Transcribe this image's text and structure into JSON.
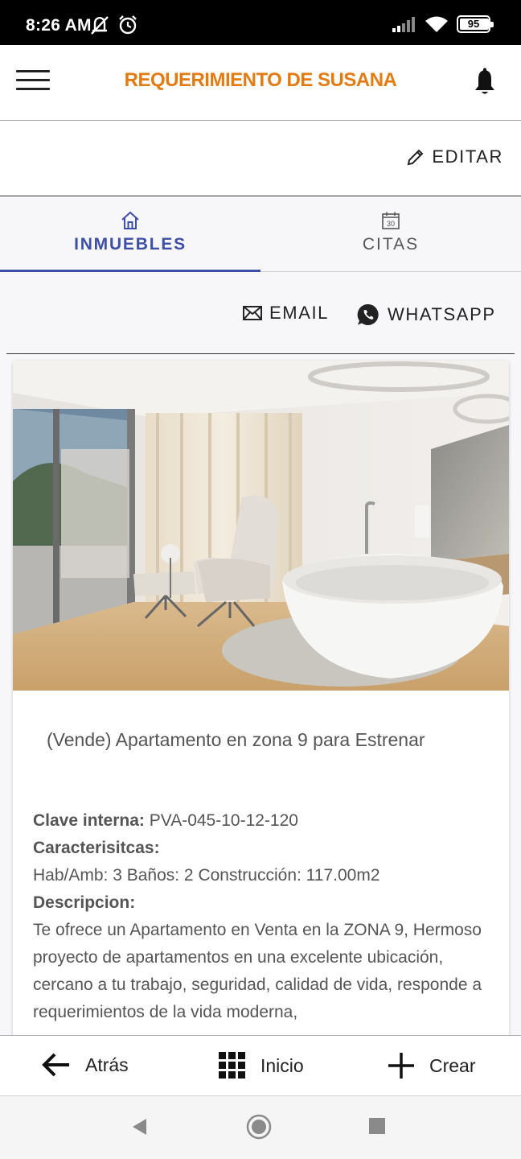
{
  "status_bar": {
    "time": "8:26 AM",
    "battery": "95",
    "battery_level": 0.95,
    "icons": [
      "mute-icon",
      "alarm-icon",
      "signal-icon",
      "wifi-icon",
      "battery-icon"
    ]
  },
  "app_bar": {
    "title": "REQUERIMIENTO DE SUSANA",
    "title_color": "#e27b12",
    "icons": [
      "menu-icon",
      "bell-icon"
    ]
  },
  "edit": {
    "label": "EDITAR",
    "icon": "pencil-icon"
  },
  "tabs": [
    {
      "label": "INMUEBLES",
      "icon": "home-icon",
      "active": true
    },
    {
      "label": "CITAS",
      "icon": "calendar-icon",
      "icon_text": "30",
      "active": false
    }
  ],
  "actions": {
    "email_label": "EMAIL",
    "whatsapp_label": "WHATSAPP"
  },
  "property": {
    "title": "(Vende) Apartamento en zona 9 para Estrenar",
    "clave_label": "Clave interna:",
    "clave_value": "PVA-045-10-12-120",
    "caracteristicas_label": "Caracterisitcas:",
    "caracteristicas_value": "Hab/Amb: 3 Baños: 2 Construcción: 117.00m2",
    "descripcion_label": "Descripcion:",
    "descripcion_value": "Te ofrece un Apartamento en Venta en la ZONA 9, Hermoso proyecto de apartamentos en una excelente ubicación, cercano a tu trabajo, seguridad, calidad de vida, responde a requerimientos de la vida moderna,"
  },
  "bottom_nav": {
    "back_label": "Atrás",
    "home_label": "Inicio",
    "create_label": "Crear"
  },
  "accent_color": "#3d4fa6"
}
